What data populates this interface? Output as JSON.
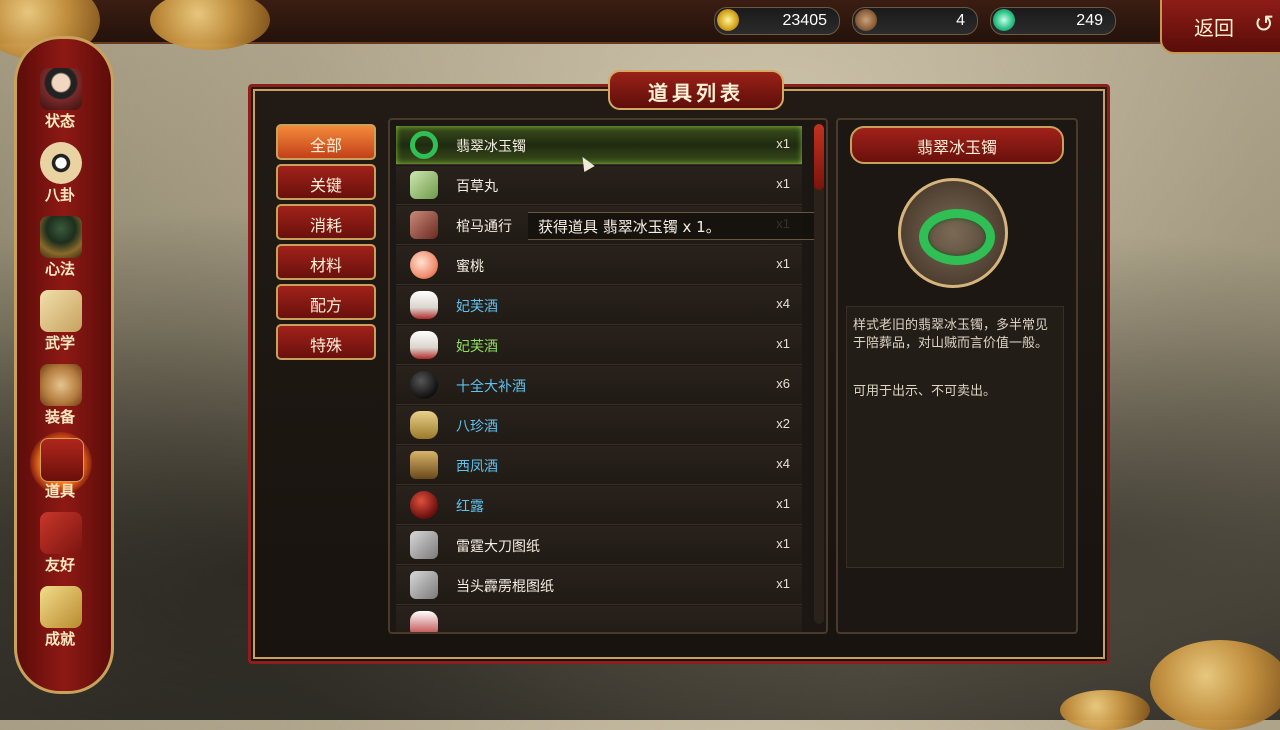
{
  "currencies": [
    {
      "icon": "gold-coin-icon",
      "value": "23405"
    },
    {
      "icon": "bronze-token-icon",
      "value": "4"
    },
    {
      "icon": "jade-gem-icon",
      "value": "249"
    }
  ],
  "back_label": "返回",
  "sidebar": {
    "items": [
      {
        "label": "状态",
        "icon": "character-portrait-icon"
      },
      {
        "label": "八卦",
        "icon": "bagua-icon"
      },
      {
        "label": "心法",
        "icon": "meditation-icon"
      },
      {
        "label": "武学",
        "icon": "scroll-book-icon"
      },
      {
        "label": "装备",
        "icon": "equipment-bundle-icon"
      },
      {
        "label": "道具",
        "icon": "chest-icon"
      },
      {
        "label": "友好",
        "icon": "red-book-icon"
      },
      {
        "label": "成就",
        "icon": "trophy-scroll-icon"
      }
    ],
    "active": "道具"
  },
  "window_title": "道具列表",
  "categories": [
    {
      "label": "全部"
    },
    {
      "label": "关键"
    },
    {
      "label": "消耗"
    },
    {
      "label": "材料"
    },
    {
      "label": "配方"
    },
    {
      "label": "特殊"
    }
  ],
  "active_category": "全部",
  "items": [
    {
      "name": "翡翠冰玉镯",
      "qty": "x1",
      "color": "#f4efe4",
      "icon": "jade-bangle-icon"
    },
    {
      "name": "百草丸",
      "qty": "x1",
      "color": "#f4efe4",
      "icon": "herb-pill-icon"
    },
    {
      "name": "棺马通行",
      "qty": "x1",
      "color": "#f4efe4",
      "icon": "pass-token-icon"
    },
    {
      "name": "蜜桃",
      "qty": "x1",
      "color": "#f4efe4",
      "icon": "peach-icon"
    },
    {
      "name": "妃芙酒",
      "qty": "x4",
      "color": "#5fc3f0",
      "icon": "wine-bottle-icon"
    },
    {
      "name": "妃芙酒",
      "qty": "x1",
      "color": "#8fe05a",
      "icon": "wine-bottle-icon"
    },
    {
      "name": "十全大补酒",
      "qty": "x6",
      "color": "#5fc3f0",
      "icon": "black-jar-icon"
    },
    {
      "name": "八珍酒",
      "qty": "x2",
      "color": "#5fc3f0",
      "icon": "gold-vase-icon"
    },
    {
      "name": "西凤酒",
      "qty": "x4",
      "color": "#5fc3f0",
      "icon": "bronze-goblet-icon"
    },
    {
      "name": "红露",
      "qty": "x1",
      "color": "#5fc3f0",
      "icon": "red-jar-icon"
    },
    {
      "name": "雷霆大刀图纸",
      "qty": "x1",
      "color": "#f4efe4",
      "icon": "blueprint-scroll-icon"
    },
    {
      "name": "当头霹雳棍图纸",
      "qty": "x1",
      "color": "#f4efe4",
      "icon": "blueprint-scroll-icon"
    }
  ],
  "tooltip": "获得道具 翡翠冰玉镯 x 1。",
  "detail": {
    "title": "翡翠冰玉镯",
    "desc1": "样式老旧的翡翠冰玉镯，多半常见于陪葬品，对山贼而言价值一般。",
    "desc2": "可用于出示、不可卖出。"
  }
}
